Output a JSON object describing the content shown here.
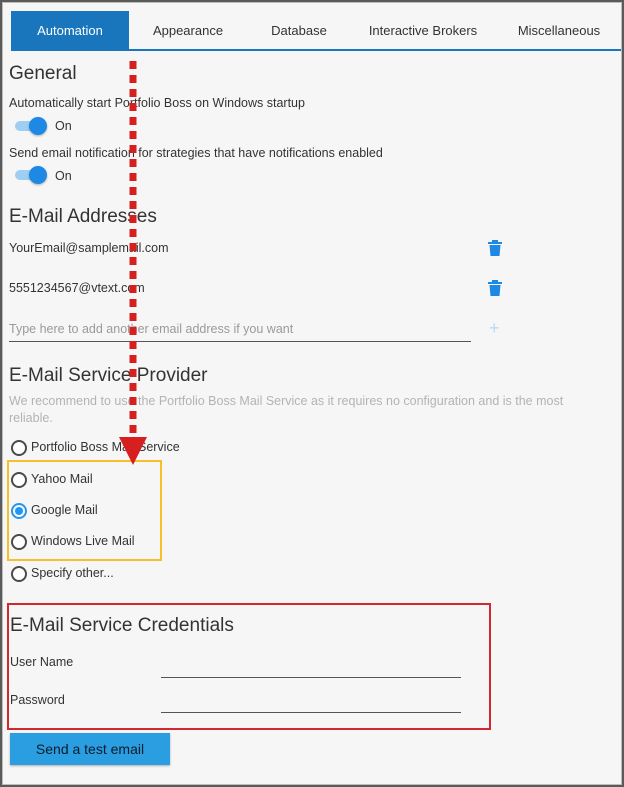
{
  "tabs": [
    {
      "label": "Automation",
      "active": true
    },
    {
      "label": "Appearance",
      "active": false
    },
    {
      "label": "Database",
      "active": false
    },
    {
      "label": "Interactive Brokers",
      "active": false
    },
    {
      "label": "Miscellaneous",
      "active": false
    }
  ],
  "general": {
    "heading": "General",
    "startup_label": "Automatically start Portfolio Boss on Windows startup",
    "startup_state": "On",
    "notify_label": "Send email notification for strategies that have notifications enabled",
    "notify_state": "On"
  },
  "emails": {
    "heading": "E-Mail Addresses",
    "items": [
      "YourEmail@samplemail.com",
      "5551234567@vtext.com"
    ],
    "add_placeholder": "Type here to add another email address if you want"
  },
  "provider": {
    "heading": "E-Mail Service Provider",
    "note": "We recommend to use the Portfolio Boss Mail Service as it requires no configuration and is the most reliable.",
    "options": [
      {
        "label": "Portfolio Boss Mail Service",
        "selected": false
      },
      {
        "label": "Yahoo Mail",
        "selected": false
      },
      {
        "label": "Google Mail",
        "selected": true
      },
      {
        "label": "Windows Live Mail",
        "selected": false
      },
      {
        "label": "Specify other...",
        "selected": false
      }
    ]
  },
  "credentials": {
    "heading": "E-Mail Service Credentials",
    "username_label": "User Name",
    "username_value": "",
    "password_label": "Password",
    "password_value": ""
  },
  "test_button": "Send a test email",
  "colors": {
    "accent": "#1976bd",
    "button": "#2a9ee0",
    "highlight_yellow": "#f5c02a",
    "highlight_red": "#d0282e",
    "arrow": "#d61f1f"
  }
}
